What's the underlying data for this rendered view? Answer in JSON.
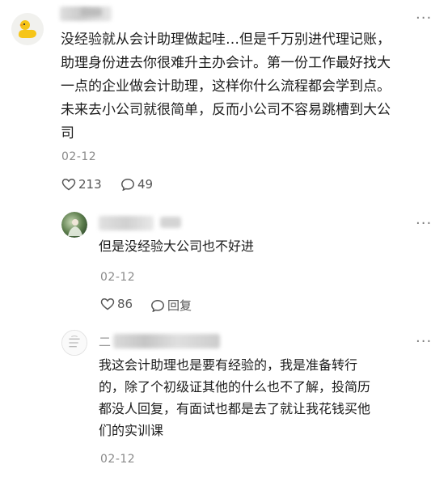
{
  "comments": [
    {
      "text_lines": [
        "没经验就从会计助理做起哇…但是千万别进代理记账，",
        "助理身份进去你很难升主办会计。第一份工作最好找大",
        "一点的企业做会计助理，这样你什么流程都会学到点。",
        "未来去小公司就很简单，反而小公司不容易跳槽到大公",
        "司"
      ],
      "date": "02-12",
      "likes": "213",
      "replies": "49",
      "avatar_icon": "duck-icon",
      "avatar_color": "#f6c518"
    }
  ],
  "replies": [
    {
      "text_lines": [
        "但是没经验大公司也不好进"
      ],
      "date": "02-12",
      "likes": "86",
      "reply_label": "回复",
      "avatar_icon": "green-photo-avatar"
    },
    {
      "username_prefix": "二",
      "text_lines": [
        "我这会计助理也是要有经验的，我是准备转行",
        "的，除了个初级证其他的什么也不了解，投简历",
        "都没人回复，有面试也都是去了就让我花钱买他",
        "们的实训课"
      ],
      "date": "02-12",
      "avatar_icon": "scroll-avatar"
    }
  ],
  "more_label": "···"
}
